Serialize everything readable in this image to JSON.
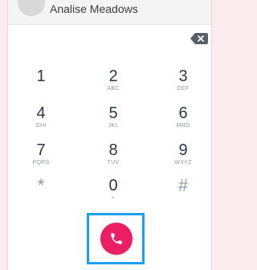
{
  "contact": {
    "name": "Analise Meadows"
  },
  "dialer": {
    "number": ""
  },
  "keypad": [
    {
      "digit": "1",
      "letters": ""
    },
    {
      "digit": "2",
      "letters": "ABC"
    },
    {
      "digit": "3",
      "letters": "DEF"
    },
    {
      "digit": "4",
      "letters": "GHI"
    },
    {
      "digit": "5",
      "letters": "JKL"
    },
    {
      "digit": "6",
      "letters": "MNO"
    },
    {
      "digit": "7",
      "letters": "PQRS"
    },
    {
      "digit": "8",
      "letters": "TUV"
    },
    {
      "digit": "9",
      "letters": "WXYZ"
    },
    {
      "digit": "*",
      "letters": ""
    },
    {
      "digit": "0",
      "letters": "+"
    },
    {
      "digit": "#",
      "letters": ""
    }
  ],
  "colors": {
    "accent": "#e91e63",
    "highlight": "#1ea0ea",
    "page_background": "#fcecef"
  },
  "icons": {
    "backspace": "backspace-icon",
    "call": "phone-icon"
  }
}
